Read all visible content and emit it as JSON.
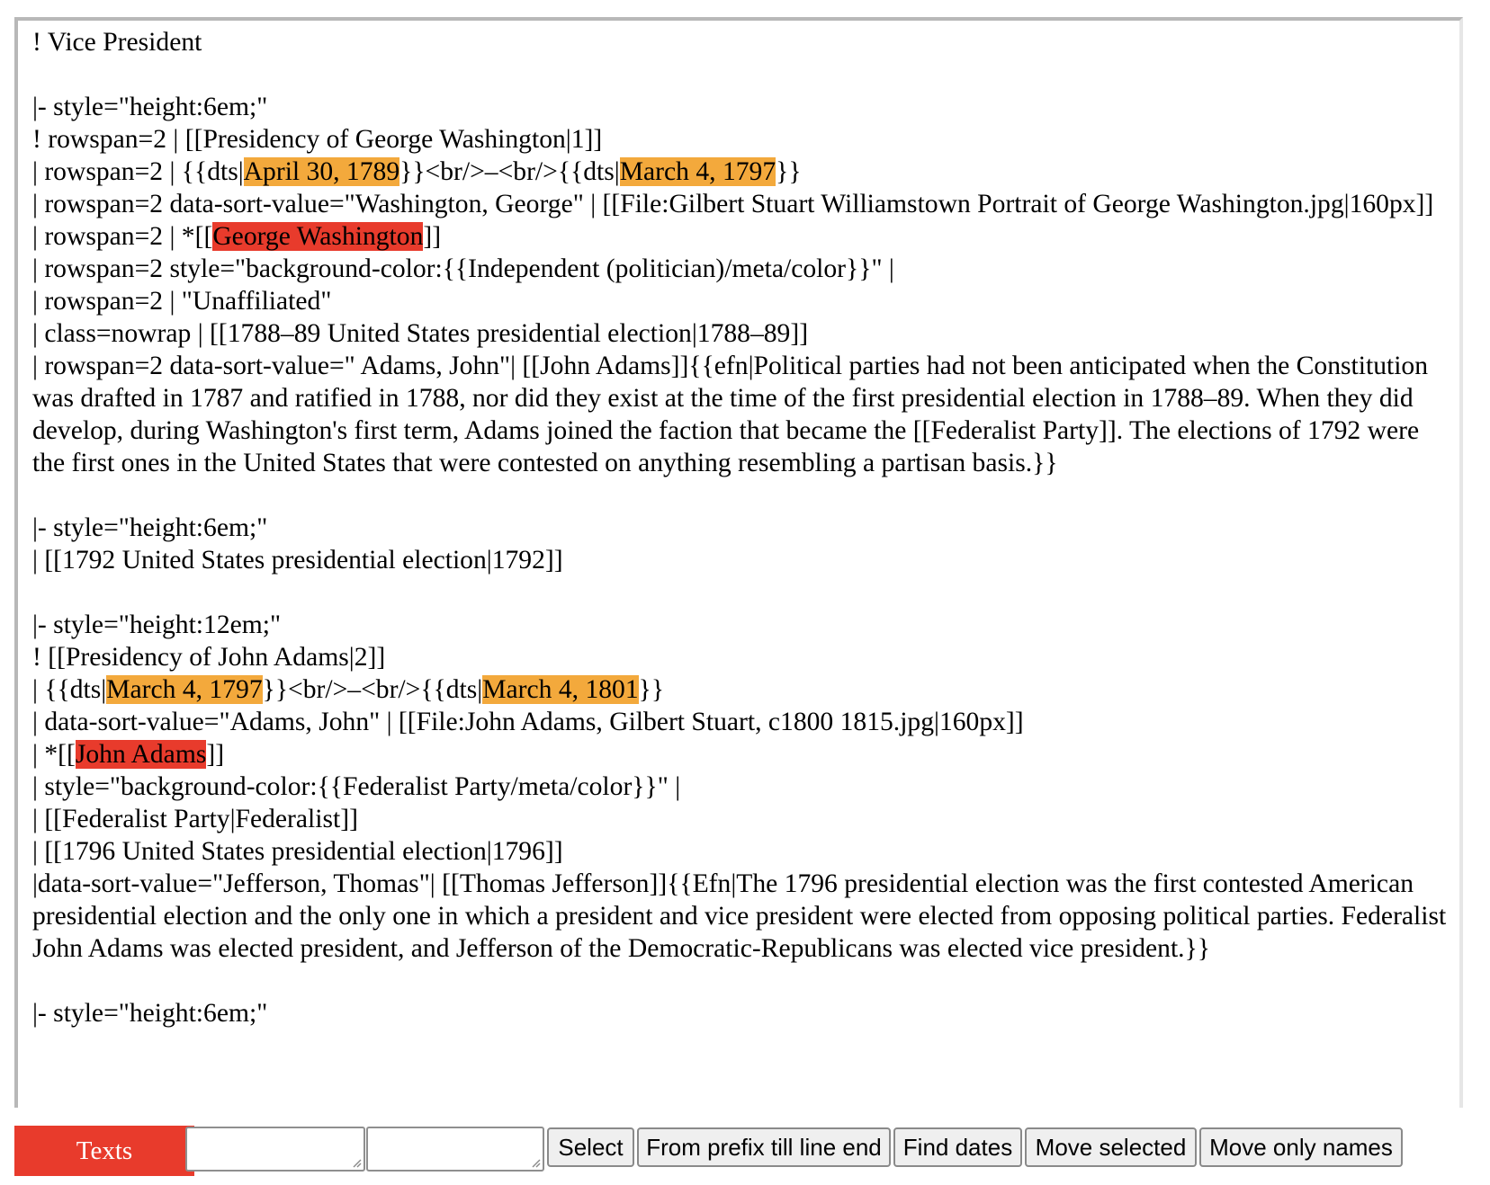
{
  "editor": {
    "lines": [
      [
        {
          "t": "! Vice President"
        }
      ],
      [
        {
          "t": ""
        }
      ],
      [
        {
          "t": "|- style=\"height:6em;\""
        }
      ],
      [
        {
          "t": "! rowspan=2 | [[Presidency of George Washington|1]]"
        }
      ],
      [
        {
          "t": "| rowspan=2 | {{dts|"
        },
        {
          "t": "April 30, 1789",
          "h": "date"
        },
        {
          "t": "}}<br/>–<br/>{{dts|"
        },
        {
          "t": "March 4, 1797",
          "h": "date"
        },
        {
          "t": "}}"
        }
      ],
      [
        {
          "t": "| rowspan=2 data-sort-value=\"Washington, George\" | [[File:Gilbert Stuart Williamstown Portrait of George Washington.jpg|160px]]"
        }
      ],
      [
        {
          "t": "| rowspan=2 | *[["
        },
        {
          "t": "George Washington",
          "h": "name"
        },
        {
          "t": "]]"
        }
      ],
      [
        {
          "t": "| rowspan=2 style=\"background-color:{{Independent (politician)/meta/color}}\" |"
        }
      ],
      [
        {
          "t": "| rowspan=2 | \"Unaffiliated\""
        }
      ],
      [
        {
          "t": "| class=nowrap | [[1788–89 United States presidential election|1788–89]]"
        }
      ],
      [
        {
          "t": "| rowspan=2 data-sort-value=\" Adams, John\"| [[John Adams]]{{efn|Political parties had not been anticipated when the Constitution was drafted in 1787 and ratified in 1788, nor did they exist at the time of the first presidential election in 1788–89. When they did develop, during Washington's first term, Adams joined the faction that became the [[Federalist Party]]. The elections of 1792 were the first ones in the United States that were contested on anything resembling a partisan basis.}}"
        }
      ],
      [
        {
          "t": ""
        }
      ],
      [
        {
          "t": "|- style=\"height:6em;\""
        }
      ],
      [
        {
          "t": "| [[1792 United States presidential election|1792]]"
        }
      ],
      [
        {
          "t": ""
        }
      ],
      [
        {
          "t": "|- style=\"height:12em;\""
        }
      ],
      [
        {
          "t": "! [[Presidency of John Adams|2]]"
        }
      ],
      [
        {
          "t": "| {{dts|"
        },
        {
          "t": "March 4, 1797",
          "h": "date"
        },
        {
          "t": "}}<br/>–<br/>{{dts|"
        },
        {
          "t": "March 4, 1801",
          "h": "date"
        },
        {
          "t": "}}"
        }
      ],
      [
        {
          "t": "| data-sort-value=\"Adams, John\" | [[File:John Adams, Gilbert Stuart, c1800 1815.jpg|160px]]"
        }
      ],
      [
        {
          "t": "| *[["
        },
        {
          "t": "John Adams",
          "h": "name"
        },
        {
          "t": "]]"
        }
      ],
      [
        {
          "t": "| style=\"background-color:{{Federalist Party/meta/color}}\" |"
        }
      ],
      [
        {
          "t": "| [[Federalist Party|Federalist]]"
        }
      ],
      [
        {
          "t": "| [[1796 United States presidential election|1796]]"
        }
      ],
      [
        {
          "t": "|data-sort-value=\"Jefferson, Thomas\"| [[Thomas Jefferson]]{{Efn|The 1796 presidential election was the first contested American presidential election and the only one in which a president and vice president were elected from opposing political parties. Federalist John Adams was elected president, and Jefferson of the Democratic-Republicans was elected vice president.}}"
        }
      ],
      [
        {
          "t": ""
        }
      ],
      [
        {
          "t": "|- style=\"height:6em;\""
        }
      ]
    ]
  },
  "toolbar": {
    "texts_label": "Texts",
    "prefix_value": "*[[",
    "suffix_value": "]]",
    "select_label": "Select",
    "from_prefix_label": "From prefix till line end",
    "find_dates_label": "Find dates",
    "move_selected_label": "Move selected",
    "move_only_names_label": "Move only names"
  },
  "colors": {
    "date_highlight": "#f3a93c",
    "name_highlight": "#e83b2c",
    "texts_label_bg": "#e83b2c"
  },
  "icons": {
    "resize_grip": "resize-grip-icon"
  }
}
